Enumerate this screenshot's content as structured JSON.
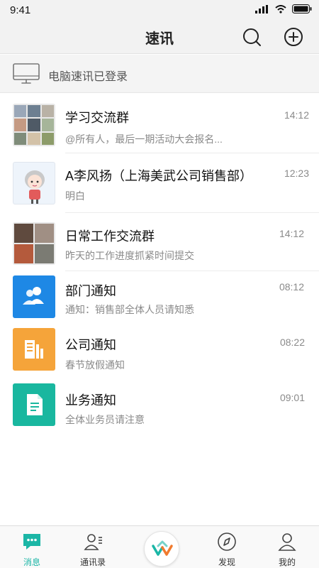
{
  "status_bar": {
    "time": "9:41"
  },
  "nav": {
    "title": "速讯"
  },
  "login_banner": {
    "text": "电脑速讯已登录"
  },
  "chats": [
    {
      "name": "学习交流群",
      "preview": "@所有人，最后一期活动大会报名...",
      "time": "14:12",
      "avatar": "group-photo-grid"
    },
    {
      "name": "A李风扬（上海美武公司销售部）",
      "preview": "明白",
      "time": "12:23",
      "avatar": "cartoon-avatar"
    },
    {
      "name": "日常工作交流群",
      "preview": "昨天的工作进度抓紧时间提交",
      "time": "14:12",
      "avatar": "group-photo-grid"
    },
    {
      "name": "部门通知",
      "preview": "通知：销售部全体人员请知悉",
      "time": "08:12",
      "avatar": "department-icon"
    },
    {
      "name": "公司通知",
      "preview": "春节放假通知",
      "time": "08:22",
      "avatar": "company-icon"
    },
    {
      "name": "业务通知",
      "preview": "全体业务员请注意",
      "time": "09:01",
      "avatar": "business-doc-icon"
    }
  ],
  "tabs": [
    {
      "label": "消息",
      "icon": "chat-bubble-icon",
      "active": true
    },
    {
      "label": "通讯录",
      "icon": "contacts-icon",
      "active": false
    },
    {
      "label": "",
      "icon": "app-logo-icon",
      "active": false
    },
    {
      "label": "发现",
      "icon": "compass-icon",
      "active": false
    },
    {
      "label": "我的",
      "icon": "person-icon",
      "active": false
    }
  ],
  "colors": {
    "accent": "#1bb6a6",
    "department_blue": "#1e88e5",
    "company_orange": "#f5a43a",
    "business_teal": "#19b79f"
  }
}
